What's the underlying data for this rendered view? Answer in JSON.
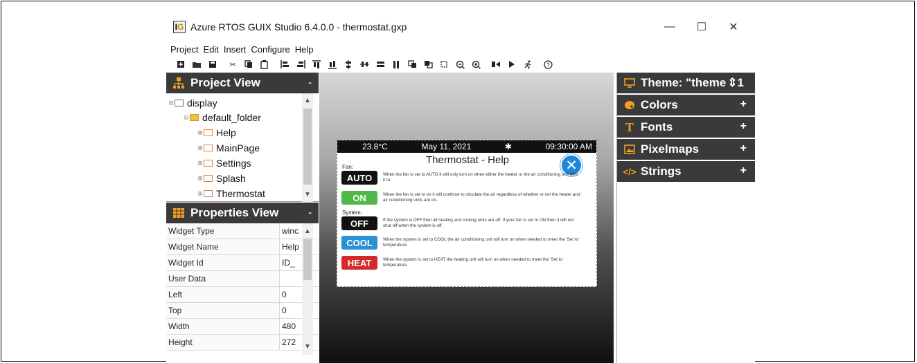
{
  "window": {
    "title": "Azure RTOS GUIX Studio 6.4.0.0 - thermostat.gxp",
    "logo_text": "G",
    "controls": {
      "minimize": "—",
      "maximize": "☐",
      "close": "✕"
    }
  },
  "menu": [
    "Project",
    "Edit",
    "Insert",
    "Configure",
    "Help"
  ],
  "project_view": {
    "title": "Project View",
    "collapse": "-",
    "tree": [
      {
        "label": "display",
        "level": 0,
        "type": "display",
        "glyph": "⊟"
      },
      {
        "label": "default_folder",
        "level": 1,
        "type": "folder",
        "glyph": "⊟"
      },
      {
        "label": "Help",
        "level": 2,
        "type": "widget",
        "glyph": "⊞"
      },
      {
        "label": "MainPage",
        "level": 2,
        "type": "widget",
        "glyph": "⊞"
      },
      {
        "label": "Settings",
        "level": 2,
        "type": "widget",
        "glyph": "⊞"
      },
      {
        "label": "Splash",
        "level": 2,
        "type": "widget",
        "glyph": "⊞"
      },
      {
        "label": "Thermostat",
        "level": 2,
        "type": "widget",
        "glyph": "⊞"
      }
    ]
  },
  "properties_view": {
    "title": "Properties View",
    "collapse": "-",
    "rows": [
      {
        "name": "Widget Type",
        "value": "winc"
      },
      {
        "name": "Widget Name",
        "value": "Help"
      },
      {
        "name": "Widget Id",
        "value": "ID_"
      },
      {
        "name": "User Data",
        "value": ""
      },
      {
        "name": "Left",
        "value": "0"
      },
      {
        "name": "Top",
        "value": "0"
      },
      {
        "name": "Width",
        "value": "480"
      },
      {
        "name": "Height",
        "value": "272"
      }
    ]
  },
  "device_screen": {
    "temperature": "23.8°C",
    "date": "May 11, 2021",
    "fan_icon": "✱",
    "time": "09:30:00 AM",
    "title": "Thermostat - Help",
    "close_glyph": "✕",
    "fan_label": "Fan:",
    "system_label": "System:",
    "buttons": [
      {
        "label": "AUTO",
        "color": "#111111",
        "desc": "When the fan is set to AUTO it will only turn on when either the heater or the air conditioning unit tells it to."
      },
      {
        "label": "ON",
        "color": "#52b84a",
        "desc": "When the fan is set to on it will continue to circulate the air regardless of whether or not the heater and air conditioning units are on."
      },
      {
        "label": "OFF",
        "color": "#111111",
        "desc": "If the system is OFF then all heating and cooling units are off. If your fan is set to ON then it will not shut off when the system is off."
      },
      {
        "label": "COOL",
        "color": "#2a8fd6",
        "desc": "When the system is set to COOL the air conditioning unit will turn on when needed to meet the 'Set to' temperature."
      },
      {
        "label": "HEAT",
        "color": "#d42a2a",
        "desc": "When the system is set to HEAT the heating unit will turn on when needed to meet the 'Set to' temperature."
      }
    ]
  },
  "resource_panel": [
    {
      "label": "Theme: \"theme",
      "icon": "display-icon",
      "suffix": "⇕1"
    },
    {
      "label": "Colors",
      "icon": "palette-icon",
      "suffix": "+"
    },
    {
      "label": "Fonts",
      "icon": "font-icon",
      "suffix": "+"
    },
    {
      "label": "Pixelmaps",
      "icon": "image-icon",
      "suffix": "+"
    },
    {
      "label": "Strings",
      "icon": "code-icon",
      "suffix": "+"
    }
  ],
  "accent_colors": {
    "panel_header": "#3a3a3a",
    "project_icon": "#f0a020",
    "properties_icon": "#f0a020"
  }
}
